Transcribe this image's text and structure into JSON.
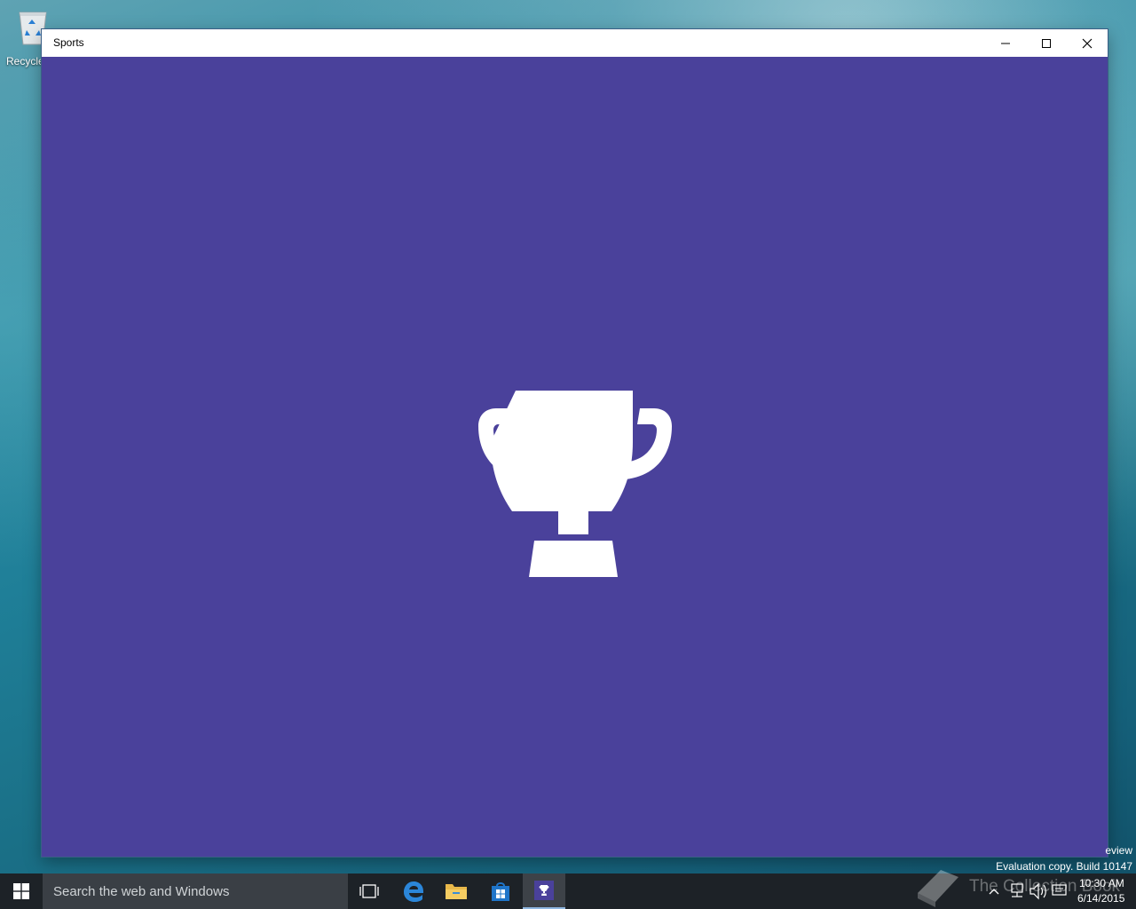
{
  "desktop": {
    "icons": [
      {
        "label": "Recycle",
        "icon": "recycle-bin-icon"
      }
    ],
    "watermarks": {
      "preview": "eview",
      "evaluation": "Evaluation copy. Build 10147",
      "site": "The Collection Book"
    }
  },
  "window": {
    "title": "Sports",
    "controls": {
      "minimize_icon": "minimize-icon",
      "maximize_icon": "maximize-icon",
      "close_icon": "close-icon"
    },
    "background": "#4a419b",
    "splash_icon": "trophy-icon"
  },
  "taskbar": {
    "background": "#1d2227",
    "search": {
      "placeholder": "Search the web and Windows"
    },
    "apps": [
      {
        "name": "Task View",
        "icon": "task-view-icon"
      },
      {
        "name": "Microsoft Edge",
        "icon": "edge-icon"
      },
      {
        "name": "File Explorer",
        "icon": "folder-icon"
      },
      {
        "name": "Store",
        "icon": "store-icon"
      },
      {
        "name": "Sports",
        "icon": "trophy-icon",
        "active": true
      }
    ],
    "tray": {
      "icons": [
        "chevron-up-icon",
        "network-icon",
        "volume-icon",
        "message-icon"
      ],
      "time": "10:30 AM",
      "date": "6/14/2015"
    }
  }
}
